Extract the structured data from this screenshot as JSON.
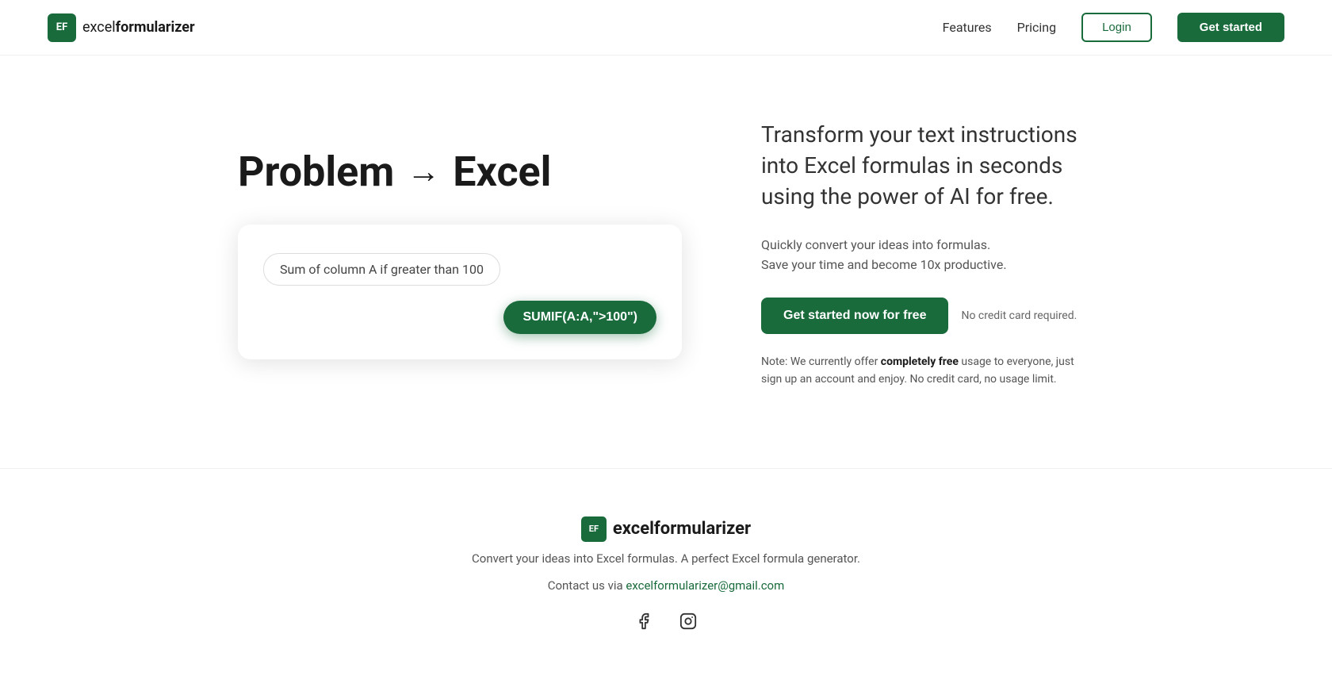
{
  "nav": {
    "logo_abbr": "EF",
    "logo_name_plain": "excel",
    "logo_name_bold": "formularizer",
    "features_label": "Features",
    "pricing_label": "Pricing",
    "login_label": "Login",
    "get_started_label": "Get started"
  },
  "hero": {
    "title_part1": "Problem",
    "title_arrow": "→",
    "title_part2": "Excel",
    "demo_input": "Sum of column A if greater than 100",
    "demo_formula": "SUMIF(A:A,\">100\")",
    "tagline": "Transform your text instructions into Excel formulas in seconds using the power of AI for free.",
    "sub_line1": "Quickly convert your ideas into formulas.",
    "sub_line2": "Save your time and become 10x productive.",
    "cta_button": "Get started now for free",
    "no_cc": "No credit card required.",
    "note": "Note: We currently offer ",
    "note_bold": "completely free",
    "note_end": " usage to everyone, just sign up an account and enjoy. No credit card, no usage limit."
  },
  "footer": {
    "logo_abbr": "EF",
    "logo_name": "excelformularizer",
    "tagline": "Convert your ideas into Excel formulas. A perfect Excel formula generator.",
    "contact_prefix": "Contact us via ",
    "contact_email": "excelformularizer@gmail.com",
    "facebook_label": "f",
    "instagram_label": "instagram"
  },
  "colors": {
    "green": "#1a6b3c",
    "green_light": "#1e7d46"
  }
}
